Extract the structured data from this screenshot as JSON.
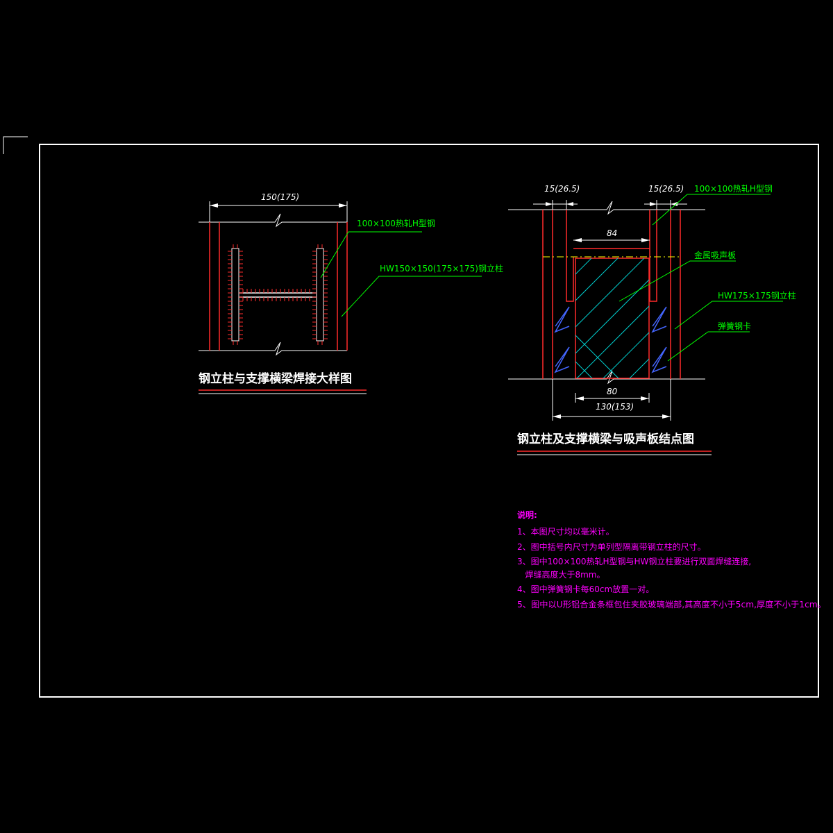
{
  "left_detail": {
    "dim_width": "150(175)",
    "label_beam": "100×100热轧H型钢",
    "label_column": "HW150×150(175×175)钢立柱",
    "title": "钢立柱与支撑横梁焊接大样图"
  },
  "right_detail": {
    "dim_left": "15(26.5)",
    "dim_right": "15(26.5)",
    "dim_inner": "84",
    "dim_panel": "80",
    "dim_total": "130(153)",
    "label_beam": "100×100热轧H型钢",
    "label_panel": "金属吸声板",
    "label_column": "HW175×175钢立柱",
    "label_clip": "弹簧钢卡",
    "title": "钢立柱及支撑横梁与吸声板结点图"
  },
  "notes": {
    "heading": "说明:",
    "items": [
      "1、本图尺寸均以毫米计。",
      "2、图中括号内尺寸为单列型隔离带钢立柱的尺寸。",
      "3、图中100×100热轧H型钢与HW钢立柱要进行双面焊缝连接,",
      "   焊缝高度大于8mm。",
      "4、图中弹簧钢卡每60cm放置一对。",
      "5、图中以U形铝合金条框包住夹胶玻璃端部,其高度不小于5cm,厚度不小于1cm。"
    ]
  },
  "colors": {
    "background": "#000000",
    "frame": "#ffffff",
    "steel": "#ff2a2a",
    "leader": "#00ff00",
    "panel": "#00cccc",
    "cut_line": "#ffff00",
    "notes": "#ff00ff"
  }
}
